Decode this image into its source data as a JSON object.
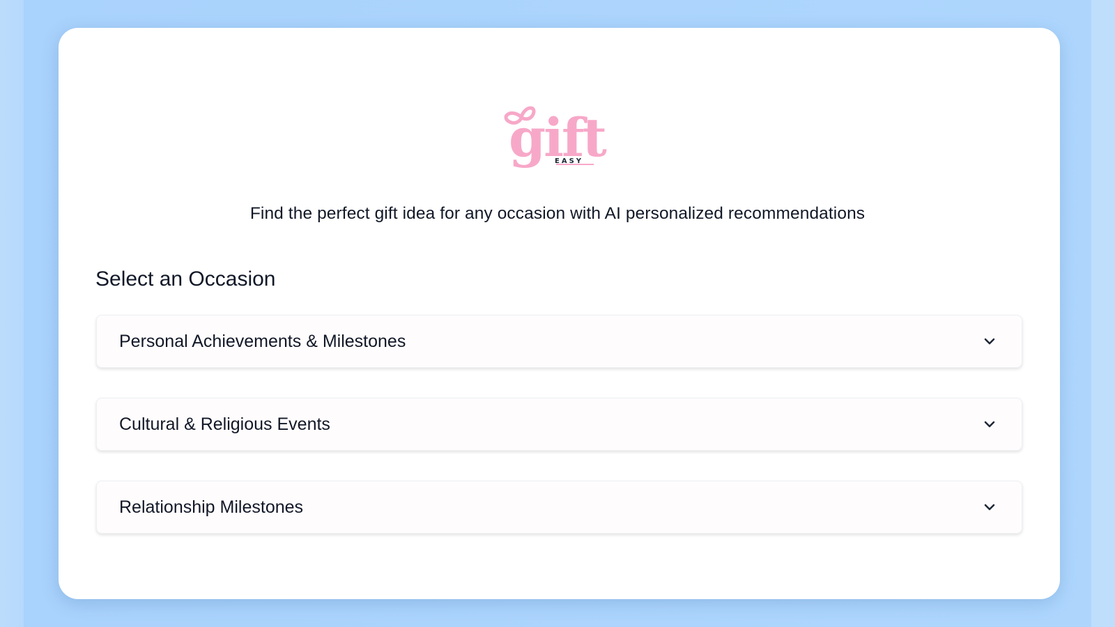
{
  "app": {
    "logo_text": "gift",
    "logo_subtext": "EASY",
    "brand_color": "#f7a8c8"
  },
  "header": {
    "tagline": "Find the perfect gift idea for any occasion with AI personalized recommendations"
  },
  "occasions": {
    "title": "Select an Occasion",
    "items": [
      {
        "label": "Personal Achievements & Milestones",
        "icon": "chevron-down-icon",
        "expanded": false
      },
      {
        "label": "Cultural & Religious Events",
        "icon": "chevron-down-icon",
        "expanded": false
      },
      {
        "label": "Relationship Milestones",
        "icon": "chevron-down-icon",
        "expanded": false
      }
    ]
  },
  "colors": {
    "background": "#aed6fd",
    "card": "#ffffff",
    "text": "#111827",
    "logo_pink": "#f7a8c8"
  }
}
